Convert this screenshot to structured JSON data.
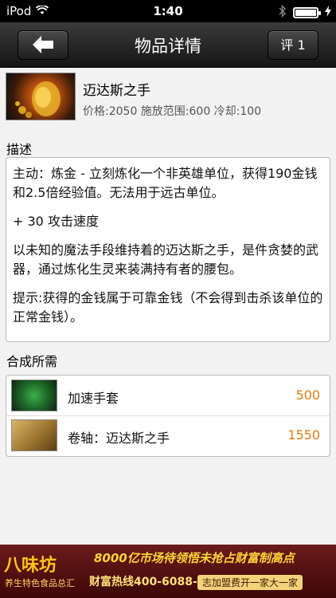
{
  "status_bar": {
    "carrier": "iPod",
    "time": "1:40"
  },
  "nav": {
    "title": "物品详情",
    "rate_label": "评 1"
  },
  "item": {
    "name": "迈达斯之手",
    "stats": "价格:2050 施放范围:600 冷却:100"
  },
  "sections": {
    "description_label": "描述",
    "recipe_label": "合成所需"
  },
  "description": {
    "p1": "主动：炼金 - 立刻炼化一个非英雄单位，获得190金钱和2.5倍经验值。无法用于远古单位。",
    "p2": "+ 30 攻击速度",
    "p3": "以未知的魔法手段维持着的迈达斯之手，是件贪婪的武器，通过炼化生灵来装满持有者的腰包。",
    "p4": "提示:获得的金钱属于可靠金钱（不会得到击杀该单位的正常金钱）。"
  },
  "recipe": [
    {
      "name": "加速手套",
      "price": "500"
    },
    {
      "name": "卷轴：迈达斯之手",
      "price": "1550"
    }
  ],
  "ad": {
    "logo": "八味坊",
    "subtitle": "养生特色食品总汇",
    "line1": "8000亿市场待领悟未抢占财富制高点",
    "line2": "财富热线400-6088-515",
    "line3": "志加盟费开一家大一家"
  },
  "colors": {
    "price_orange": "#e07d10",
    "nav_bg": "#1f1f1f"
  }
}
